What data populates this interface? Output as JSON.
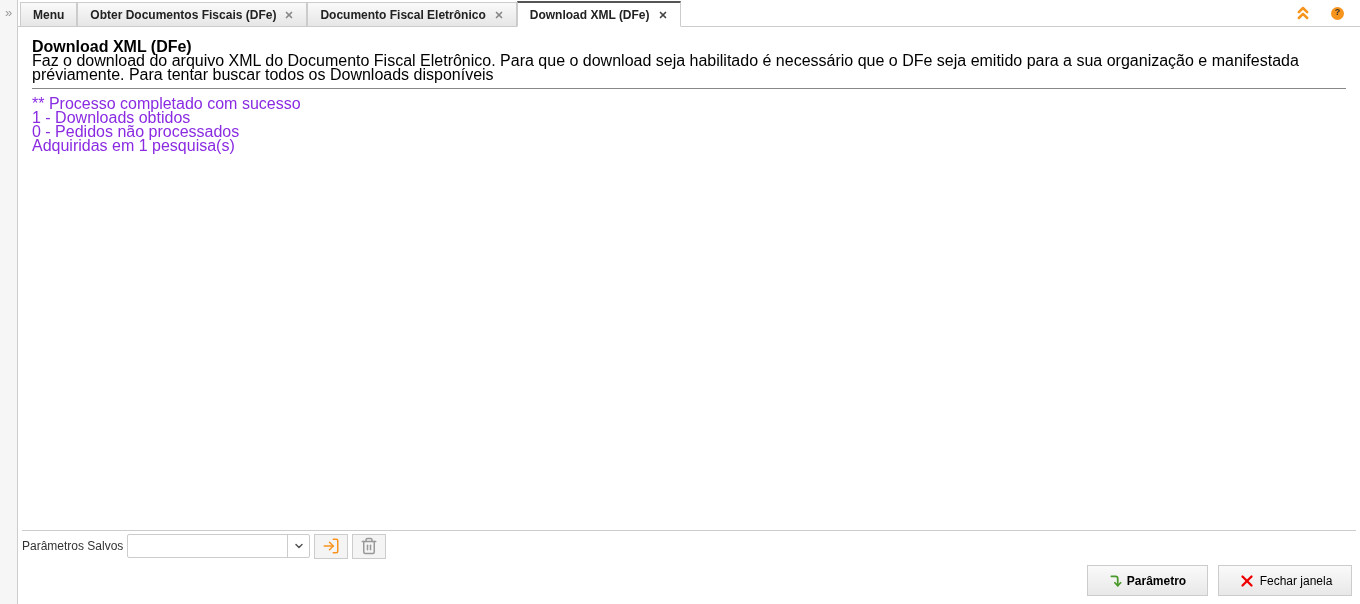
{
  "sidebar": {
    "expand_glyph": "»"
  },
  "tabs": [
    {
      "label": "Menu",
      "closable": false,
      "selected": false
    },
    {
      "label": "Obter Documentos Fiscais (DFe)",
      "closable": true,
      "selected": false
    },
    {
      "label": "Documento Fiscal Eletrônico",
      "closable": true,
      "selected": false
    },
    {
      "label": "Download XML (DFe)",
      "closable": true,
      "selected": true
    }
  ],
  "help": {
    "glyph": "?"
  },
  "header": {
    "title": "Download XML (DFe)",
    "description": "Faz o download do arquivo XML do Documento Fiscal Eletrônico. Para que o download seja habilitado é necessário que o DFe seja emitido para a sua organização e manifestada préviamente. Para tentar buscar todos os Downloads disponíveis"
  },
  "messages": [
    "** Processo completado com sucesso",
    "1 - Downloads obtidos",
    "0 - Pedidos não processados",
    "Adquiridas em 1 pesquisa(s)"
  ],
  "saved_params": {
    "label": "Parâmetros Salvos"
  },
  "buttons": [
    {
      "kind": "parameter",
      "label": "Parâmetro"
    },
    {
      "kind": "close",
      "label": "Fechar janela"
    }
  ]
}
